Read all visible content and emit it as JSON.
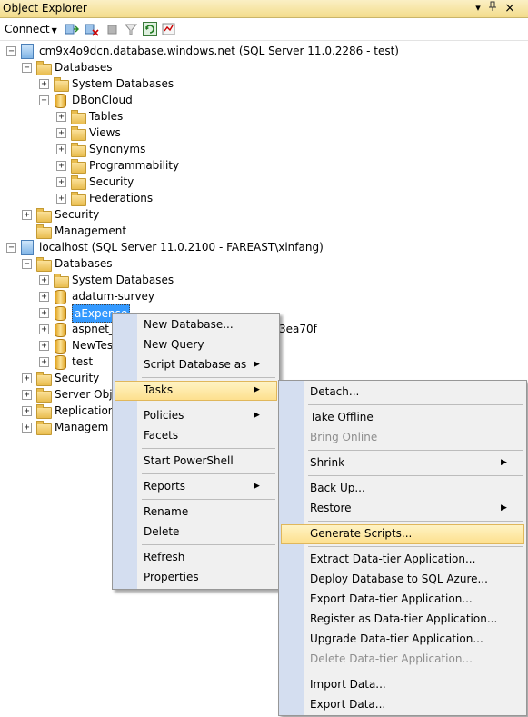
{
  "window": {
    "title": "Object Explorer",
    "controls": {
      "pin": "▾",
      "autohide": "ᚋ",
      "close": "×"
    }
  },
  "toolbar": {
    "connect_label": "Connect",
    "icons": [
      "connect-object-explorer-icon",
      "disconnect-icon",
      "stop-icon",
      "filter-icon",
      "refresh-icon",
      "activity-monitor-icon"
    ]
  },
  "tree": {
    "nodes": [
      {
        "text": "cm9x4o9dcn.database.windows.net (SQL Server 11.0.2286 - test)",
        "level": 0,
        "icon": "server-cloud",
        "expander": "−"
      },
      {
        "text": "Databases",
        "level": 1,
        "icon": "folder",
        "expander": "−"
      },
      {
        "text": "System Databases",
        "level": 2,
        "icon": "folder",
        "expander": "+"
      },
      {
        "text": "DBonCloud",
        "level": 2,
        "icon": "database",
        "expander": "−"
      },
      {
        "text": "Tables",
        "level": 3,
        "icon": "folder",
        "expander": "+"
      },
      {
        "text": "Views",
        "level": 3,
        "icon": "folder",
        "expander": "+"
      },
      {
        "text": "Synonyms",
        "level": 3,
        "icon": "folder",
        "expander": "+"
      },
      {
        "text": "Programmability",
        "level": 3,
        "icon": "folder",
        "expander": "+"
      },
      {
        "text": "Security",
        "level": 3,
        "icon": "folder",
        "expander": "+"
      },
      {
        "text": "Federations",
        "level": 3,
        "icon": "folder",
        "expander": "+"
      },
      {
        "text": "Security",
        "level": 1,
        "icon": "folder",
        "expander": "+"
      },
      {
        "text": "Management",
        "level": 1,
        "icon": "folder",
        "expander": ""
      },
      {
        "text": "localhost (SQL Server 11.0.2100 - FAREAST\\xinfang)",
        "level": 0,
        "icon": "server",
        "expander": "−"
      },
      {
        "text": "Databases",
        "level": 1,
        "icon": "folder",
        "expander": "−"
      },
      {
        "text": "System Databases",
        "level": 2,
        "icon": "folder",
        "expander": "+"
      },
      {
        "text": "adatum-survey",
        "level": 2,
        "icon": "database",
        "expander": "+"
      },
      {
        "text": "aExpense",
        "level": 2,
        "icon": "database",
        "expander": "+",
        "selected": true
      },
      {
        "text": "aspnet_",
        "level": 2,
        "icon": "database",
        "expander": "+"
      },
      {
        "text": "NewTes",
        "level": 2,
        "icon": "database",
        "expander": "+"
      },
      {
        "text": "test",
        "level": 2,
        "icon": "database",
        "expander": "+"
      },
      {
        "text": "Security",
        "level": 1,
        "icon": "folder",
        "expander": "+"
      },
      {
        "text": "Server Obj",
        "level": 1,
        "icon": "folder",
        "expander": "+"
      },
      {
        "text": "Replication",
        "level": 1,
        "icon": "folder",
        "expander": "+"
      },
      {
        "text": "Managem",
        "level": 1,
        "icon": "folder",
        "expander": "+"
      }
    ],
    "partial_text_right_of_menu": "3ea70f"
  },
  "context_menu": {
    "items": [
      {
        "label": "New Database...",
        "submenu": false
      },
      {
        "label": "New Query",
        "submenu": false
      },
      {
        "label": "Script Database as",
        "submenu": true
      },
      {
        "sep": true
      },
      {
        "label": "Tasks",
        "submenu": true,
        "highlighted": true
      },
      {
        "sep": true
      },
      {
        "label": "Policies",
        "submenu": true
      },
      {
        "label": "Facets",
        "submenu": false
      },
      {
        "sep": true
      },
      {
        "label": "Start PowerShell",
        "submenu": false
      },
      {
        "sep": true
      },
      {
        "label": "Reports",
        "submenu": true
      },
      {
        "sep": true
      },
      {
        "label": "Rename",
        "submenu": false
      },
      {
        "label": "Delete",
        "submenu": false
      },
      {
        "sep": true
      },
      {
        "label": "Refresh",
        "submenu": false
      },
      {
        "label": "Properties",
        "submenu": false
      }
    ]
  },
  "tasks_submenu": {
    "items": [
      {
        "label": "Detach...",
        "submenu": false
      },
      {
        "sep": true
      },
      {
        "label": "Take Offline",
        "submenu": false
      },
      {
        "label": "Bring Online",
        "submenu": false,
        "disabled": true
      },
      {
        "sep": true
      },
      {
        "label": "Shrink",
        "submenu": true
      },
      {
        "sep": true
      },
      {
        "label": "Back Up...",
        "submenu": false
      },
      {
        "label": "Restore",
        "submenu": true
      },
      {
        "sep": true
      },
      {
        "label": "Generate Scripts...",
        "submenu": false,
        "highlighted": true
      },
      {
        "sep": true
      },
      {
        "label": "Extract Data-tier Application...",
        "submenu": false
      },
      {
        "label": "Deploy Database to SQL Azure...",
        "submenu": false
      },
      {
        "label": "Export Data-tier Application...",
        "submenu": false
      },
      {
        "label": "Register as Data-tier Application...",
        "submenu": false
      },
      {
        "label": "Upgrade Data-tier Application...",
        "submenu": false
      },
      {
        "label": "Delete Data-tier Application...",
        "submenu": false,
        "disabled": true
      },
      {
        "sep": true
      },
      {
        "label": "Import Data...",
        "submenu": false
      },
      {
        "label": "Export Data...",
        "submenu": false
      }
    ]
  },
  "colors": {
    "title_bg": "#f3dc8c",
    "selection": "#3399ff",
    "menu_bg": "#f0f0f0",
    "menu_gutter": "#d4def0",
    "highlight": "#fde08e",
    "disabled_text": "#8d8d8d"
  }
}
